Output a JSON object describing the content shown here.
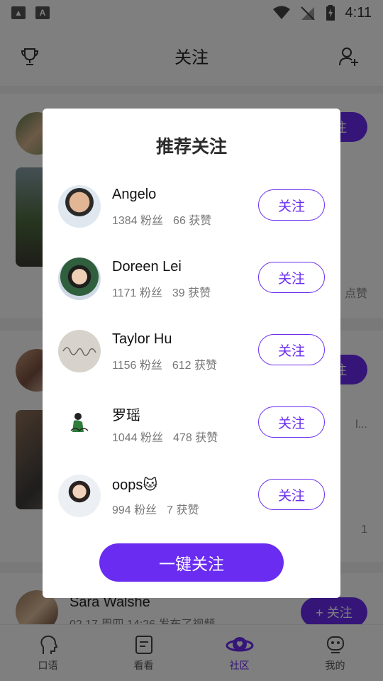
{
  "status_bar": {
    "time": "4:11"
  },
  "header": {
    "title": "关注"
  },
  "feed": {
    "follow_label": "关注",
    "like_label": "点赞",
    "partial_text": "l...",
    "like_count": "1",
    "last_post": {
      "name": "Sara Walshe",
      "meta": "02.17 周四 14:26 发布了视频",
      "follow_label": "+ 关注"
    }
  },
  "modal": {
    "title": "推荐关注",
    "follow_label": "关注",
    "follow_all_label": "一键关注",
    "users": [
      {
        "name": "Angelo",
        "fans": "1384 粉丝",
        "likes": "66 获赞"
      },
      {
        "name": "Doreen Lei",
        "fans": "1171 粉丝",
        "likes": "39 获赞"
      },
      {
        "name": "Taylor Hu",
        "fans": "1156 粉丝",
        "likes": "612 获赞"
      },
      {
        "name": "罗瑶",
        "fans": "1044 粉丝",
        "likes": "478 获赞"
      },
      {
        "name": "oops🐱",
        "fans": "994 粉丝",
        "likes": "7 获赞"
      }
    ]
  },
  "bottom_nav": {
    "items": [
      {
        "label": "口语"
      },
      {
        "label": "看看"
      },
      {
        "label": "社区"
      },
      {
        "label": "我的"
      }
    ]
  },
  "colors": {
    "accent": "#6a2cf0"
  }
}
